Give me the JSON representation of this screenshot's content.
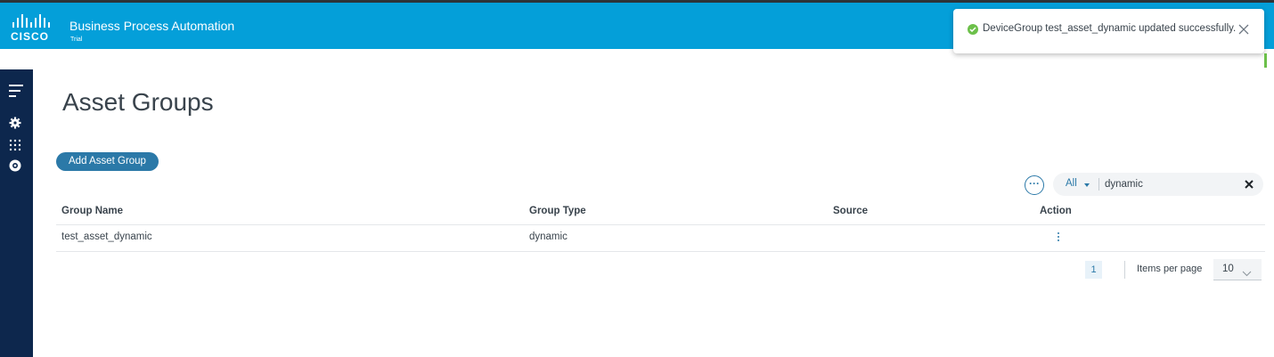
{
  "header": {
    "brand": "CISCO",
    "app_title": "Business Process Automation",
    "app_subtitle": "Trial"
  },
  "toast": {
    "message": "DeviceGroup test_asset_dynamic updated successfully.",
    "status_color": "#6cc04a"
  },
  "sidebar": {
    "icons": [
      "menu-icon",
      "gear-icon",
      "grid-icon",
      "settings-badge-icon"
    ]
  },
  "page": {
    "title": "Asset Groups",
    "add_button_label": "Add Asset Group"
  },
  "filter": {
    "more_label": "···",
    "scope": "All",
    "value": "dynamic"
  },
  "table": {
    "columns": [
      "Group Name",
      "Group Type",
      "Source",
      "Action"
    ],
    "rows": [
      {
        "group_name": "test_asset_dynamic",
        "group_type": "dynamic",
        "source": ""
      }
    ]
  },
  "pagination": {
    "current_page": "1",
    "items_per_page_label": "Items per page",
    "items_per_page": "10"
  },
  "colors": {
    "header_bg": "#049fd9",
    "sidebar_bg": "#0d274d",
    "accent": "#2b79a8"
  }
}
